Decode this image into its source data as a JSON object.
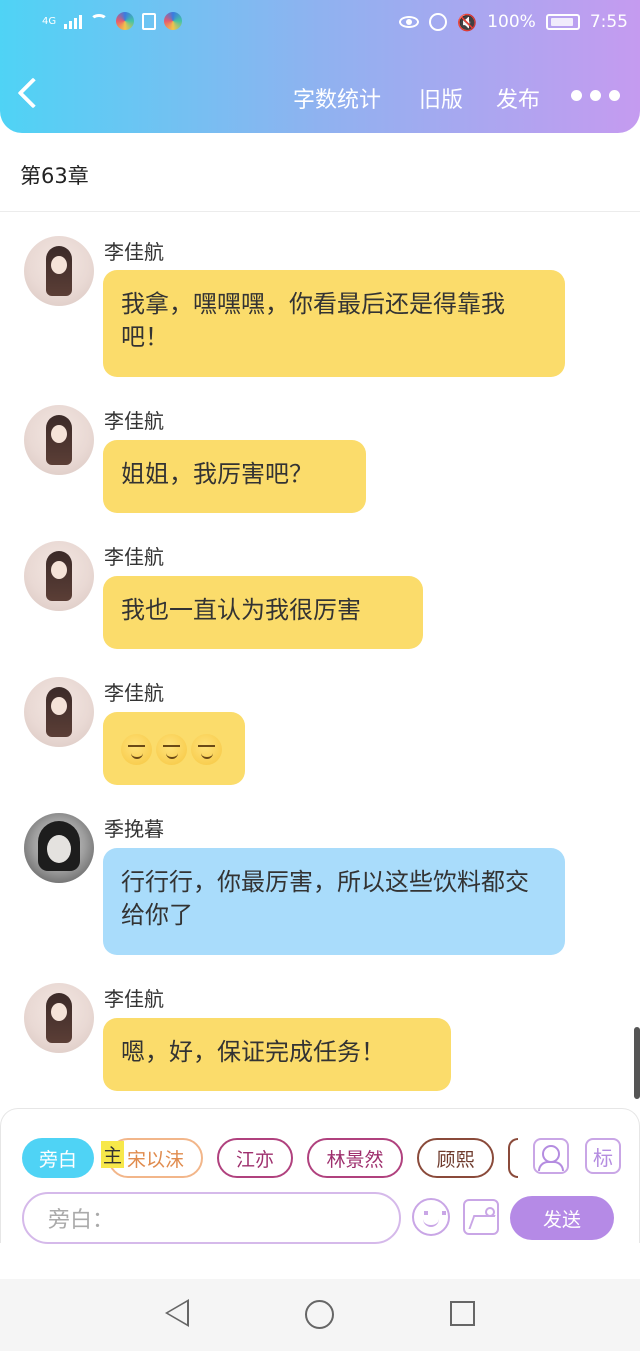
{
  "status_bar": {
    "network": "4G",
    "battery": "100%",
    "time": "7:55"
  },
  "nav": {
    "stats_label": "字数统计",
    "old_version_label": "旧版",
    "publish_label": "发布"
  },
  "chapter_title": "第63章",
  "messages": [
    {
      "sender": "李佳航",
      "text": "我拿，嘿嘿嘿，你看最后还是得靠我吧！",
      "bubble_color": "#fbdc6b"
    },
    {
      "sender": "李佳航",
      "text": "姐姐，我厉害吧？",
      "bubble_color": "#fbdc6b"
    },
    {
      "sender": "李佳航",
      "text": "我也一直认为我很厉害",
      "bubble_color": "#fbdc6b"
    },
    {
      "sender": "李佳航",
      "text": "",
      "emoji_count": 3,
      "emoji": "smirk-emoji",
      "bubble_color": "#fbdc6b"
    },
    {
      "sender": "季挽暮",
      "text": "行行行，你最厉害，所以这些饮料都交给你了",
      "bubble_color": "#a9dcfb"
    },
    {
      "sender": "李佳航",
      "text": "嗯，好，保证完成任务！",
      "bubble_color": "#fbdc6b"
    }
  ],
  "characters": [
    "旁白",
    "宋以沫",
    "江亦",
    "林景然",
    "顾熙"
  ],
  "highlight_char": "主",
  "tag_button": "标",
  "input": {
    "placeholder": "旁白："
  },
  "send_label": "发送",
  "colors": {
    "accent": "#b58ae6",
    "header_start": "#4fd3f5",
    "header_end": "#c59bf0"
  }
}
